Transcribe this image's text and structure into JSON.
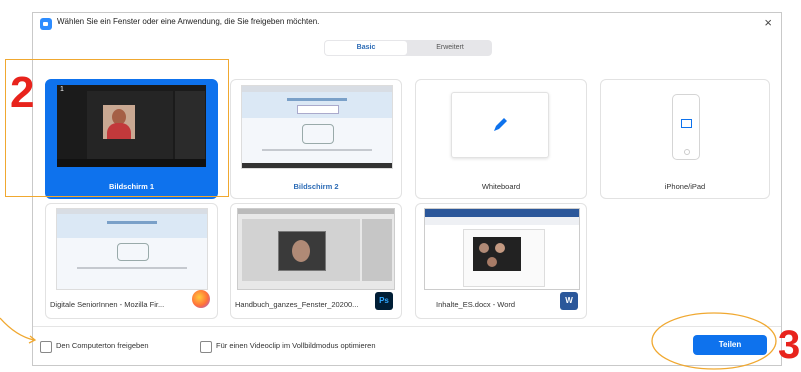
{
  "dialog": {
    "title": "Wählen Sie ein Fenster oder eine Anwendung, die Sie freigeben möchten.",
    "close_symbol": "×"
  },
  "tabs": [
    {
      "label": "Basic",
      "active": true
    },
    {
      "label": "Erweitert",
      "active": false
    }
  ],
  "cards": [
    {
      "label": "Bildschirm 1",
      "selected": true,
      "number": "1"
    },
    {
      "label": "Bildschirm 2",
      "selected": false
    },
    {
      "label": "Whiteboard",
      "selected": false,
      "icon": "pen-icon"
    },
    {
      "label": "iPhone/iPad",
      "selected": false,
      "icon": "phone-icon"
    },
    {
      "label": "Digitale SeniorInnen - Mozilla Fir...",
      "selected": false,
      "app_icon": "firefox-icon"
    },
    {
      "label": "Handbuch_ganzes_Fenster_20200...",
      "selected": false,
      "app_icon": "photoshop-icon",
      "app_badge": "Ps"
    },
    {
      "label": "Inhalte_ES.docx - Word",
      "selected": false,
      "app_icon": "word-icon",
      "app_badge": "W"
    }
  ],
  "options": {
    "computer_sound": "Den Computerton freigeben",
    "video_optimize": "Für einen Videoclip im Vollbildmodus optimieren"
  },
  "share_button": "Teilen",
  "annotations": {
    "step2": "2",
    "step3": "3"
  },
  "colors": {
    "accent": "#0e72ed",
    "annotation": "#e8231c",
    "highlight_box": "#f0a830"
  }
}
